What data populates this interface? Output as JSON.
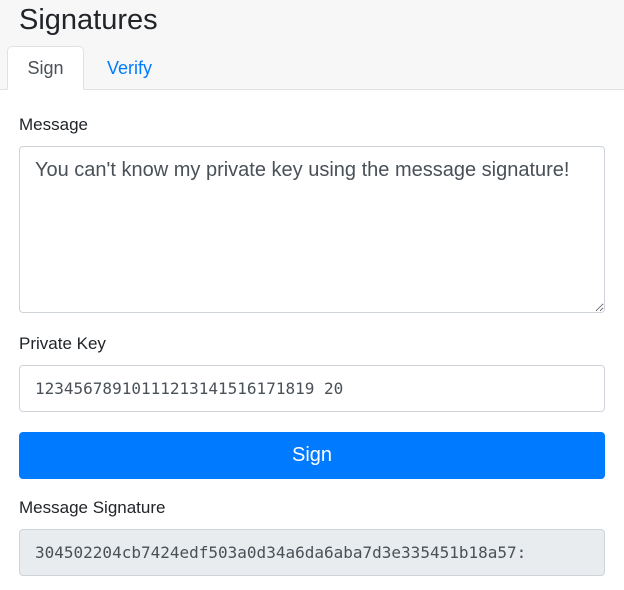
{
  "header": {
    "title": "Signatures",
    "tabs": [
      {
        "label": "Sign",
        "active": true
      },
      {
        "label": "Verify",
        "active": false
      }
    ]
  },
  "form": {
    "message_label": "Message",
    "message_value": "You can't know my private key using the message signature!",
    "private_key_label": "Private Key",
    "private_key_value": "12345678910111213141516171819 20",
    "sign_button_label": "Sign",
    "signature_label": "Message Signature",
    "signature_value": "304502204cb7424edf503a0d34a6da6aba7d3e335451b18a57:"
  },
  "colors": {
    "accent": "#007bff",
    "header_bg": "#f7f7f7",
    "readonly_bg": "#e9ecef"
  }
}
